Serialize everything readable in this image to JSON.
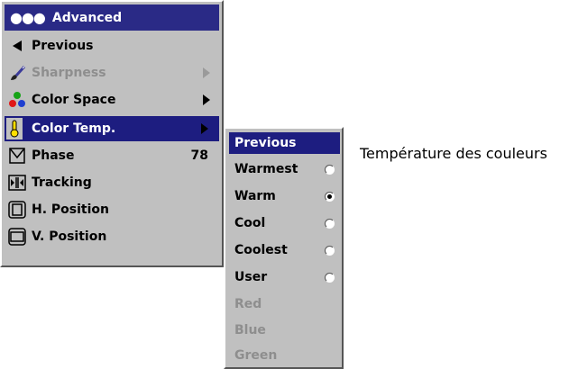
{
  "main_menu": {
    "header": "Advanced",
    "items": [
      {
        "label": "Previous"
      },
      {
        "label": "Sharpness"
      },
      {
        "label": "Color Space"
      },
      {
        "label": "Color Temp."
      },
      {
        "label": "Phase",
        "value": "78"
      },
      {
        "label": "Tracking"
      },
      {
        "label": "H. Position"
      },
      {
        "label": "V. Position"
      }
    ]
  },
  "sub_menu": {
    "items": [
      {
        "label": "Previous"
      },
      {
        "label": "Warmest"
      },
      {
        "label": "Warm"
      },
      {
        "label": "Cool"
      },
      {
        "label": "Coolest"
      },
      {
        "label": "User"
      },
      {
        "label": "Red"
      },
      {
        "label": "Blue"
      },
      {
        "label": "Green"
      }
    ],
    "selected_option": "Warm"
  },
  "caption": "Température des couleurs",
  "colors": {
    "menu_bg": "#c0c0c0",
    "highlight": "#1d1d80",
    "disabled_text": "#8e8e8e"
  }
}
